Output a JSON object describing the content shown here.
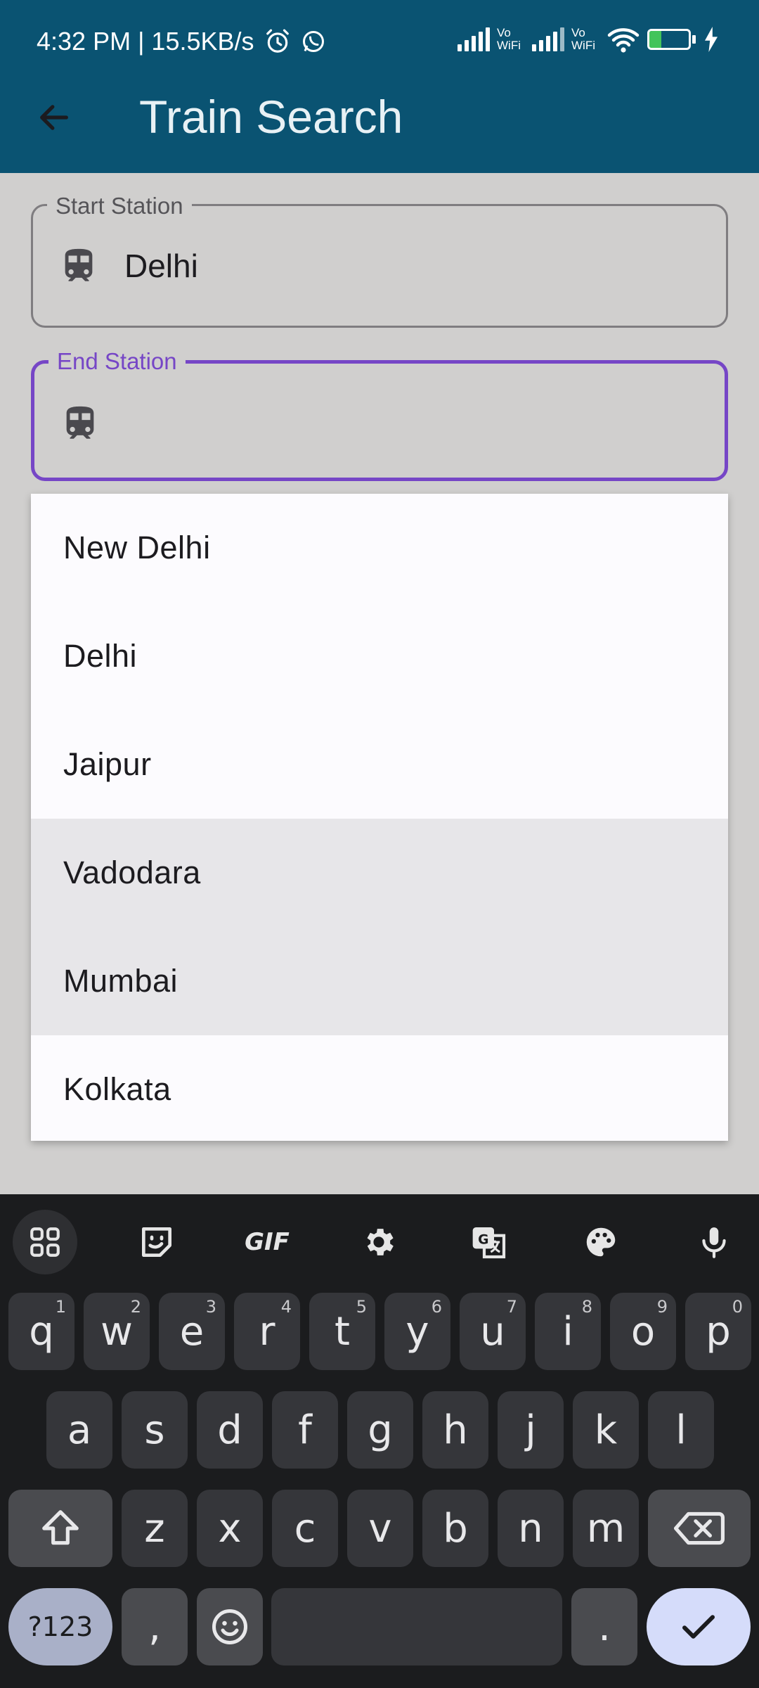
{
  "status_bar": {
    "time_speed": "4:32 PM | 15.5KB/s",
    "vowifi_1": "Vo\nWiFi",
    "vowifi_2": "Vo\nWiFi",
    "battery_level": "30",
    "battery_fraction": 0.3
  },
  "app_bar": {
    "title": "Train Search"
  },
  "start_field": {
    "label": "Start Station",
    "value": "Delhi"
  },
  "end_field": {
    "label": "End Station",
    "value": ""
  },
  "dropdown": {
    "items": [
      "New Delhi",
      "Delhi",
      "Jaipur",
      "Vadodara",
      "Mumbai",
      "Kolkata"
    ]
  },
  "keyboard": {
    "row1": [
      {
        "k": "q",
        "h": "1"
      },
      {
        "k": "w",
        "h": "2"
      },
      {
        "k": "e",
        "h": "3"
      },
      {
        "k": "r",
        "h": "4"
      },
      {
        "k": "t",
        "h": "5"
      },
      {
        "k": "y",
        "h": "6"
      },
      {
        "k": "u",
        "h": "7"
      },
      {
        "k": "i",
        "h": "8"
      },
      {
        "k": "o",
        "h": "9"
      },
      {
        "k": "p",
        "h": "0"
      }
    ],
    "row2": [
      "a",
      "s",
      "d",
      "f",
      "g",
      "h",
      "j",
      "k",
      "l"
    ],
    "row3": [
      "z",
      "x",
      "c",
      "v",
      "b",
      "n",
      "m"
    ],
    "sym_label": "?123",
    "comma_label": ",",
    "period_label": "."
  },
  "colors": {
    "app_bar": "#0a5372",
    "focus_accent": "#7646c6",
    "keyboard_bg": "#1b1c1e"
  }
}
